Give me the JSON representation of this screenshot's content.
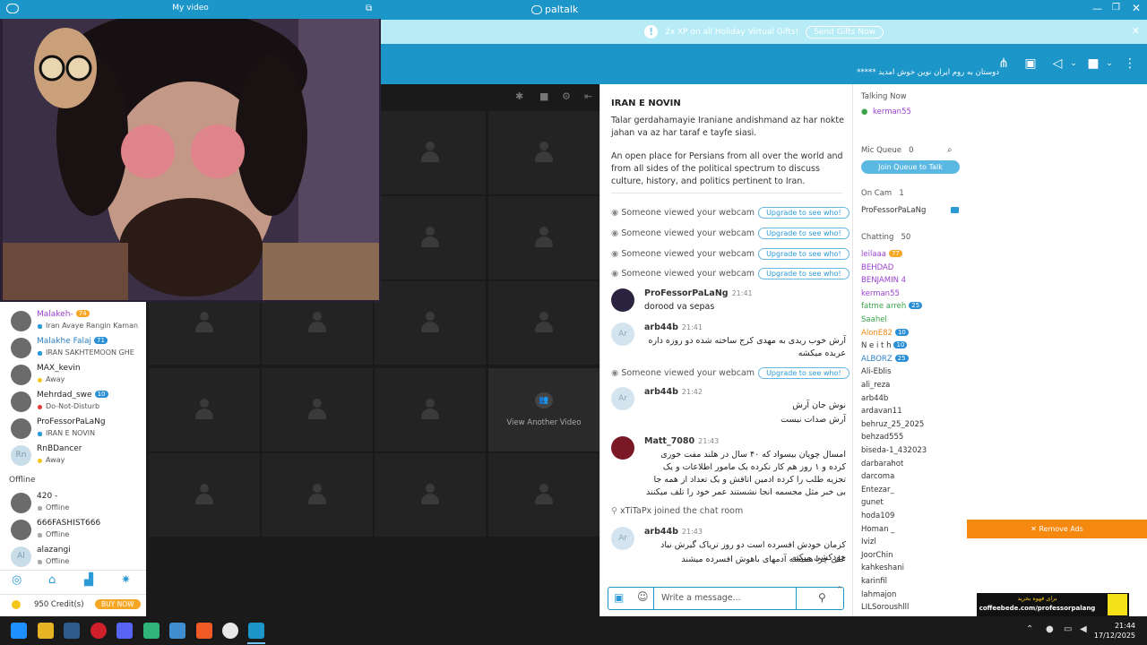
{
  "app": {
    "title": "paltalk"
  },
  "banner": {
    "text": "2x XP on all Holiday Virtual Gifts!",
    "button": "Send Gifts Now"
  },
  "marquee": "***** دوستان به روم ایران نوین خوش آمدید",
  "my_video": {
    "title": "My video"
  },
  "room": {
    "name": "IRAN E NOVIN",
    "desc1": "Talar gerdahamayie Iraniane andishmand az har nokte jahan va az har taraf e tayfe siasi.",
    "desc2": "An open place for Persians from all over the world and from all sides of the political spectrum to discuss culture, history, and politics pertinent to Iran."
  },
  "chat": {
    "webcam_text": "Someone viewed your webcam",
    "upgrade_label": "Upgrade to see who!",
    "messages": [
      {
        "user": "ProFessorPaLaNg",
        "time": "21:41",
        "text": "dorood va sepas"
      },
      {
        "user": "arb44b",
        "time": "21:41",
        "avatar": "Ar",
        "text": "آرش خوب ریدی به مهدی کرج ساخته شده دو روزه داره عربده میکشه"
      },
      {
        "user": "arb44b",
        "time": "21:42",
        "avatar": "Ar",
        "text": "نوش جان آرش",
        "text2": "آرش صدات نیست"
      },
      {
        "user": "Matt_7080",
        "time": "21:43",
        "text": "امسال چوپان بیسواد که ۴۰ سال در هلند مفت خوری کرده و ۱ روز هم کار نکرده یک مامور اطلاعات و یک تجزیه طلب را کرده ادمین اتاقش و یک تعداد از همه جا بی خبر مثل مجسمه انجا نشستند عمر خود را تلف میکنند"
      },
      {
        "user": "arb44b",
        "time": "21:43",
        "avatar": "Ar",
        "text": "کرمان خودش افسرده است دو روز تریاک گیرش نیاد خودکشی میکنه",
        "text2": "علی چرا همیشه آدمهای باهوش افسرده میشند"
      }
    ],
    "joined": "xTiTaPx joined the chat room",
    "input_placeholder": "Write a message..."
  },
  "users_panel": {
    "talking_now_label": "Talking Now",
    "talking_user": "kerman55",
    "mic_queue_label": "Mic Queue",
    "mic_queue_count": "0",
    "join_queue_button": "Join Queue to Talk",
    "on_cam_label": "On Cam",
    "on_cam_count": "1",
    "on_cam_user": "ProFessorPaLaNg",
    "chatting_label": "Chatting",
    "chatting_count": "50",
    "chatting": [
      {
        "name": "leilaaa",
        "color": "#9b3fd1",
        "badge": "77"
      },
      {
        "name": "BEHDAD",
        "color": "#9b3fd1"
      },
      {
        "name": "BENJAMIN 4",
        "color": "#9b3fd1"
      },
      {
        "name": "kerman55",
        "color": "#9b3fd1"
      },
      {
        "name": "fatme arreh",
        "color": "#3aa34a",
        "badge": "25"
      },
      {
        "name": "Saahel",
        "color": "#3aa34a"
      },
      {
        "name": "AlonE82",
        "color": "#e8850f",
        "badge": "10"
      },
      {
        "name": "N e i t h",
        "color": "#333",
        "badge": "10"
      },
      {
        "name": "ALBORZ",
        "color": "#2a7fc4",
        "badge": "25"
      },
      {
        "name": "Ali-Eblis",
        "color": "#333"
      },
      {
        "name": "ali_reza",
        "color": "#333"
      },
      {
        "name": "arb44b",
        "color": "#333"
      },
      {
        "name": "ardavan11",
        "color": "#333"
      },
      {
        "name": "behruz_25_2025",
        "color": "#333"
      },
      {
        "name": "behzad555",
        "color": "#333"
      },
      {
        "name": "biseda-1_432023",
        "color": "#333"
      },
      {
        "name": "darbarahot",
        "color": "#333"
      },
      {
        "name": "darcoma",
        "color": "#333"
      },
      {
        "name": "Entezar_",
        "color": "#333"
      },
      {
        "name": "gunet",
        "color": "#333"
      },
      {
        "name": "hoda109",
        "color": "#333"
      },
      {
        "name": "Homan _",
        "color": "#333"
      },
      {
        "name": "Ivizl",
        "color": "#333"
      },
      {
        "name": "JoorChin",
        "color": "#333"
      },
      {
        "name": "kahkeshani",
        "color": "#333"
      },
      {
        "name": "karinfil",
        "color": "#333"
      },
      {
        "name": "lahmajon",
        "color": "#333"
      },
      {
        "name": "LILSoroushlll",
        "color": "#333"
      }
    ]
  },
  "left_users": [
    {
      "name": "Malakeh-",
      "status": "Iran Avaye Rangin Kaman",
      "badge": "74",
      "name_color": "#9b3fd1"
    },
    {
      "name": "Malakhe Falaj",
      "status": "IRAN SAKHTEMOON GHE",
      "badge": "71",
      "name_color": "#2a7fc4"
    },
    {
      "name": "MAX_kevin",
      "status": "Away",
      "dot": "#f5c518"
    },
    {
      "name": "Mehrdad_swe",
      "status": "Do-Not-Disturb",
      "badge": "10",
      "dot": "#e53935"
    },
    {
      "name": "ProFessorPaLaNg",
      "status": "IRAN E NOVIN"
    },
    {
      "name": "RnBDancer",
      "status": "Away",
      "avatar": "Rn",
      "dot": "#f5c518"
    }
  ],
  "offline_label": "Offline",
  "offline_users": [
    {
      "name": "420 -",
      "status": "Offline"
    },
    {
      "name": "666FASHIST666",
      "status": "Offline"
    },
    {
      "name": "alazangi",
      "status": "Offline",
      "avatar": "Al"
    }
  ],
  "credits": {
    "text": "950 Credit(s)",
    "buy": "BUY NOW"
  },
  "view_another": "View Another Video",
  "ads": {
    "remove": "✕ Remove Ads",
    "promo_top": "برای قهوه بخرید",
    "promo_url": "coffeebede.com/professorpalang"
  },
  "clock": {
    "time": "21:44",
    "date": "17/12/2025"
  },
  "accent": "#1c95c9"
}
